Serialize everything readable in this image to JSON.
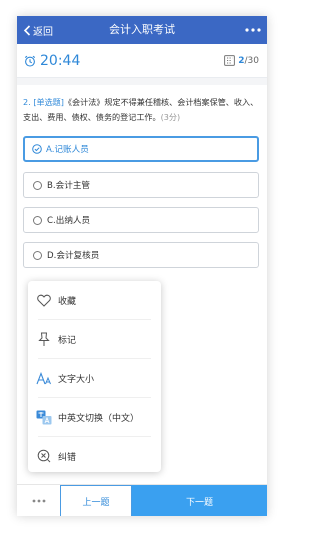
{
  "navbar": {
    "back_label": "返回",
    "title": "会计入职考试",
    "more_icon": "more-horizontal-icon"
  },
  "status": {
    "timer": "20:44",
    "current": "2",
    "total": "/30"
  },
  "question": {
    "number": "2.",
    "type": "[单选题]",
    "text": "《会计法》规定不得兼任稽核、会计档案保管、收入、支出、费用、债权、债务的登记工作。",
    "score": "(3分)"
  },
  "options": [
    {
      "label": "A.记账人员",
      "selected": true
    },
    {
      "label": "B.会计主管",
      "selected": false
    },
    {
      "label": "C.出纳人员",
      "selected": false
    },
    {
      "label": "D.会计复核员",
      "selected": false
    }
  ],
  "menu": {
    "items": [
      {
        "label": "收藏",
        "icon": "heart-icon"
      },
      {
        "label": "标记",
        "icon": "pin-icon"
      },
      {
        "label": "文字大小",
        "icon": "font-size-icon"
      },
      {
        "label": "中英文切换（中文）",
        "icon": "translate-icon"
      },
      {
        "label": "纠错",
        "icon": "error-report-icon"
      }
    ]
  },
  "footer": {
    "prev_label": "上一题",
    "next_label": "下一题"
  },
  "colors": {
    "navbar": "#3b68c4",
    "accent": "#2f88d8",
    "next_button": "#3aa0f0"
  }
}
